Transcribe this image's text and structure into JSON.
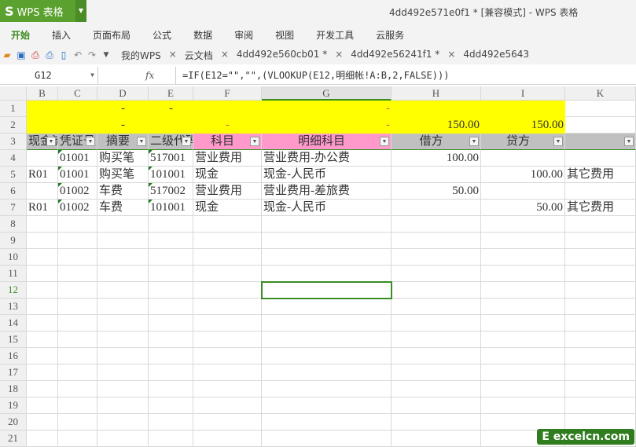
{
  "app": {
    "logo": "WPS 表格",
    "title": "4dd492e571e0f1 * [兼容模式] - WPS 表格"
  },
  "ribbon": [
    "开始",
    "插入",
    "页面布局",
    "公式",
    "数据",
    "审阅",
    "视图",
    "开发工具",
    "云服务"
  ],
  "doc_tabs": [
    "我的WPS",
    "云文档",
    "4dd492e560cb01 *",
    "4dd492e56241f1 *",
    "4dd492e5643"
  ],
  "formula_bar": {
    "name_box": "G12",
    "fx": "fx",
    "formula": "=IF(E12=\"\",\"\",(VLOOKUP(E12,明细帐!A:B,2,FALSE)))"
  },
  "columns": [
    "B",
    "C",
    "D",
    "E",
    "F",
    "G",
    "H",
    "I",
    "K"
  ],
  "rows": [
    [
      "",
      "",
      "-",
      "-",
      "",
      "-",
      "",
      "",
      ""
    ],
    [
      "",
      "",
      "-",
      "",
      "-",
      "-",
      "150.00",
      "150.00",
      ""
    ],
    [
      "现金流",
      "凭证号",
      "摘要",
      "二级代码",
      "科目",
      "明细科目",
      "借方",
      "贷方",
      ""
    ],
    [
      "",
      "01001",
      "购买笔",
      "517001",
      "营业费用",
      "营业费用-办公费",
      "100.00",
      "",
      ""
    ],
    [
      "R01",
      "01001",
      "购买笔",
      "101001",
      "现金",
      "现金-人民币",
      "",
      "100.00",
      "其它费用"
    ],
    [
      "",
      "01002",
      "车费",
      "517002",
      "营业费用",
      "营业费用-差旅费",
      "50.00",
      "",
      ""
    ],
    [
      "R01",
      "01002",
      "车费",
      "101001",
      "现金",
      "现金-人民币",
      "",
      "50.00",
      "其它费用"
    ]
  ],
  "total_rows": 21,
  "selected_cell": "G12",
  "colors": {
    "yellow": "#ffff00",
    "pink": "#ff99cc",
    "gray": "#c0c0c0",
    "accent": "#3a8d23"
  },
  "watermark": "Excelcn.com"
}
